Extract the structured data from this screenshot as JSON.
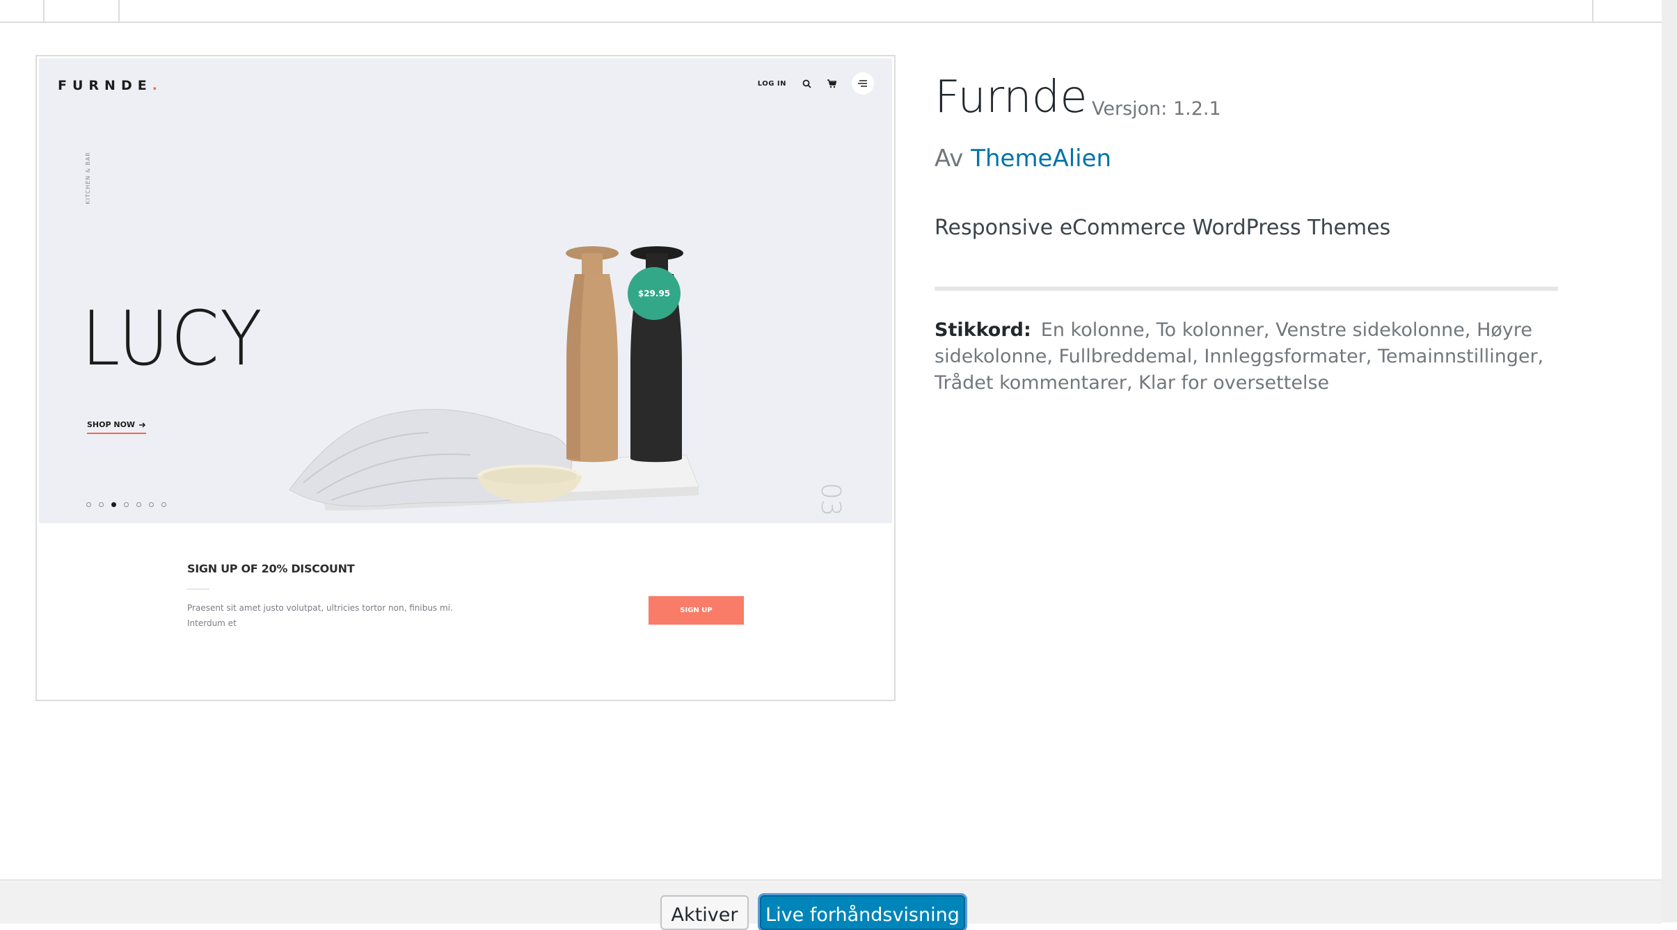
{
  "theme": {
    "name": "Furnde",
    "version": "Versjon: 1.2.1",
    "author_prefix": "Av",
    "author_name": "ThemeAlien",
    "description": "Responsive eCommerce WordPress Themes",
    "tags_label": "Stikkord:",
    "tags_text": "En kolonne, To kolonner, Venstre sidekolonne, Høyre sidekolonne, Fullbreddemal, Innleggsformater, Temainnstillinger, Trådet kommentarer, Klar for oversettelse"
  },
  "screenshot": {
    "logo": "FURNDE",
    "logo_dot": ".",
    "login": "LOG IN",
    "vertical_label": "KITCHEN & BAR",
    "hero_title": "LUCY",
    "shop_now": "SHOP NOW",
    "price": "$29.95",
    "slide_number": "03",
    "slides_count": 7,
    "active_slide": 3,
    "signup_title": "SIGN UP OF 20% DISCOUNT",
    "signup_text": "Praesent sit amet justo volutpat, ultricies tortor non, finibus mi. Interdum et",
    "signup_button": "SIGN UP"
  },
  "footer": {
    "activate_label": "Aktiver",
    "live_preview_label": "Live forhåndsvisning"
  },
  "colors": {
    "link": "#0073aa",
    "primary_button": "#0085ba",
    "accent_coral": "#f97c68",
    "price_badge": "#33a888"
  }
}
